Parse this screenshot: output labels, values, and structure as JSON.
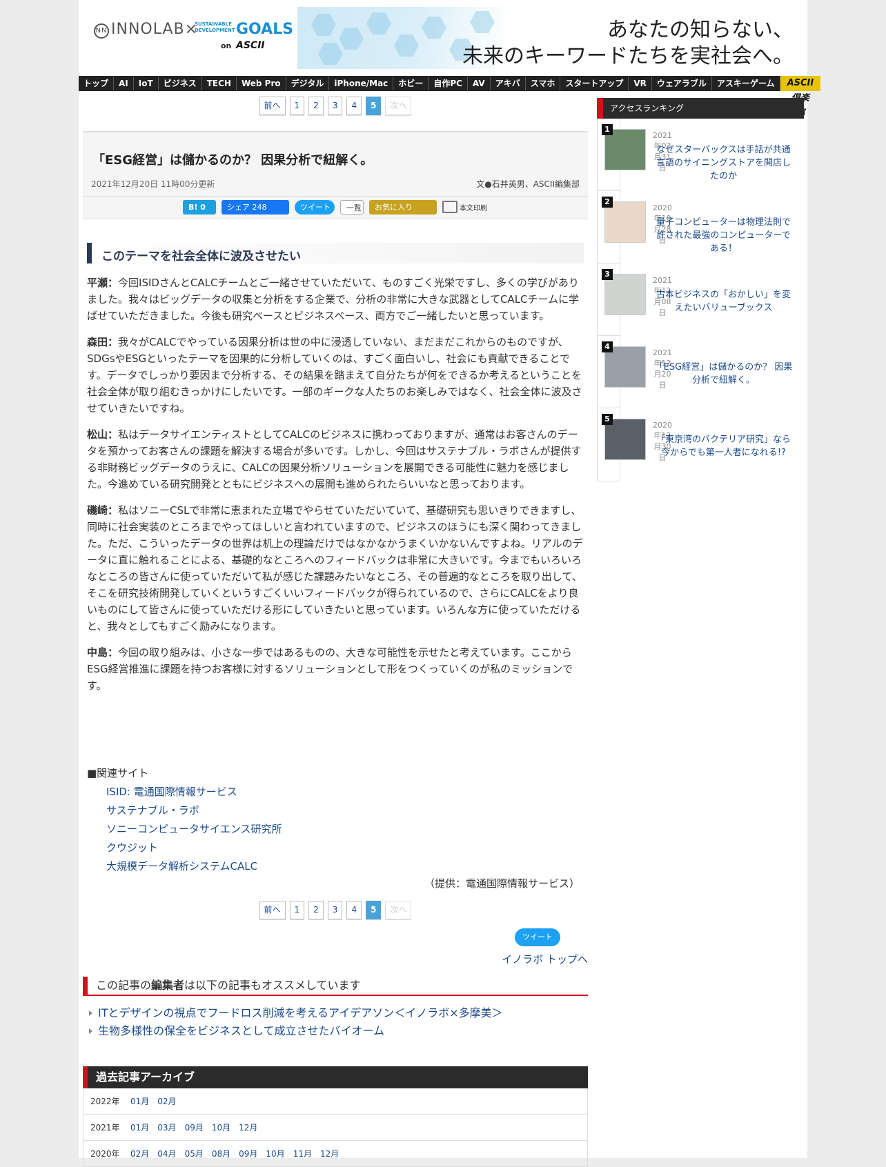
{
  "header": {
    "logo_innolab": "INNOLAB",
    "logo_x": "×",
    "logo_sdg_small_1": "SUSTAINABLE",
    "logo_sdg_small_2": "DEVELOPMENT",
    "logo_goals": "GOALS",
    "logo_on": "on",
    "logo_ascii": "ASCII",
    "banner_line1": "あなたの知らない、",
    "banner_line2": "未来のキーワードたちを実社会へ。"
  },
  "nav": {
    "items": [
      "トップ",
      "AI",
      "IoT",
      "ビジネス",
      "TECH",
      "Web Pro",
      "デジタル",
      "iPhone/Mac",
      "ホビー",
      "自作PC",
      "AV",
      "アキバ",
      "スマホ",
      "スタートアップ",
      "VR",
      "ウェアラブル",
      "アスキーゲーム"
    ],
    "club": "ASCII倶楽部"
  },
  "pager": {
    "prev": "前へ",
    "pages": [
      "1",
      "2",
      "3",
      "4",
      "5"
    ],
    "next": "次へ"
  },
  "article": {
    "title": "「ESG経営」は儲かるのか？ 因果分析で紐解く。",
    "date": "2021年12月20日 11時00分更新",
    "author": "文●石井英男、ASCII編集部",
    "share": {
      "hatena": "B! 0",
      "facebook": "シェア 248",
      "twitter": "ツイート",
      "list": "一覧",
      "fav": "お気に入り",
      "print": "本文印刷"
    },
    "section_heading": "このテーマを社会全体に波及させたい",
    "paragraphs": [
      {
        "speaker": "平瀬：",
        "text": "今回ISIDさんとCALCチームとご一緒させていただいて、ものすごく光栄ですし、多くの学びがありました。我々はビッグデータの収集と分析をする企業で、分析の非常に大きな武器としてCALCチームに学ばせていただきました。今後も研究ベースとビジネスベース、両方でご一緒したいと思っています。"
      },
      {
        "speaker": "森田：",
        "text": "我々がCALCでやっている因果分析は世の中に浸透していない、まだまだこれからのものですが、SDGsやESGといったテーマを因果的に分析していくのは、すごく面白いし、社会にも貢献できることです。データでしっかり要因まで分析する、その結果を踏まえて自分たちが何をできるか考えるということを社会全体が取り組むきっかけにしたいです。一部のギークな人たちのお楽しみではなく、社会全体に波及させていきたいですね。"
      },
      {
        "speaker": "松山：",
        "text": "私はデータサイエンティストとしてCALCのビジネスに携わっておりますが、通常はお客さんのデータを預かってお客さんの課題を解決する場合が多いです。しかし、今回はサステナブル・ラボさんが提供する非財務ビッグデータのうえに、CALCの因果分析ソリューションを展開できる可能性に魅力を感じました。今進めている研究開発とともにビジネスへの展開も進められたらいいなと思っております。"
      },
      {
        "speaker": "磯崎：",
        "text": "私はソニーCSLで非常に恵まれた立場でやらせていただいていて、基礎研究も思いきりできますし、同時に社会実装のところまでやってほしいと言われていますので、ビジネスのほうにも深く関わってきました。ただ、こういったデータの世界は机上の理論だけではなかなかうまくいかないんですよね。リアルのデータに直に触れることによる、基礎的なところへのフィードバックは非常に大きいです。今までもいろいろなところの皆さんに使っていただいて私が感じた課題みたいなところ、その普遍的なところを取り出して、そこを研究技術開発していくというすごくいいフィードバックが得られているので、さらにCALCをより良いものにして皆さんに使っていただける形にしていきたいと思っています。いろんな方に使っていただけると、我々としてもすごく励みになります。"
      },
      {
        "speaker": "中島：",
        "text": "今回の取り組みは、小さな一歩ではあるものの、大きな可能性を示せたと考えています。ここからESG経営推進に課題を持つお客様に対するソリューションとして形をつくっていくのが私のミッションです。"
      }
    ],
    "related_head": "■関連サイト",
    "related_links": [
      "ISID: 電通国際情報サービス",
      "サステナブル・ラボ",
      "ソニーコンピュータサイエンス研究所",
      "クウジット",
      "大規模データ解析システムCALC"
    ],
    "credit": "（提供：電通国際情報サービス）",
    "tweet2": "ツイート",
    "top_link": " イノラボ トップへ"
  },
  "recommend": {
    "heading_pre": "この記事の",
    "heading_em": "編集者",
    "heading_post": "は以下の記事もオススメしています ",
    "items": [
      "ITとデザインの視点でフードロス削減を考えるアイデアソン＜イノラボ×多摩美＞",
      "生物多様性の保全をビジネスとして成立させたバイオーム"
    ]
  },
  "archive": {
    "heading": "過去記事アーカイブ",
    "rows": [
      {
        "year": "2022年",
        "months": [
          "01月",
          "02月"
        ]
      },
      {
        "year": "2021年",
        "months": [
          "01月",
          "03月",
          "09月",
          "10月",
          "12月"
        ]
      },
      {
        "year": "2020年",
        "months": [
          "02月",
          "04月",
          "05月",
          "08月",
          "09月",
          "10月",
          "11月",
          "12月"
        ]
      }
    ]
  },
  "sidebar": {
    "heading": "アクセスランキング",
    "items": [
      {
        "rank": "1",
        "date": "2021年03月31日",
        "title": "なぜスターバックスは手話が共通言語のサイニングストアを開店したのか"
      },
      {
        "rank": "2",
        "date": "2020年10月28日",
        "title": "量子コンピューターは物理法則で許された最強のコンピューターである！"
      },
      {
        "rank": "3",
        "date": "2021年12月08日",
        "title": "古本ビジネスの「おかしい」を変えたいバリューブックス"
      },
      {
        "rank": "4",
        "date": "2021年12月20日",
        "title": "「ESG経営」は儲かるのか？ 因果分析で紐解く。"
      },
      {
        "rank": "5",
        "date": "2020年12月30日",
        "title": "「東京湾のバクテリア研究」なら今からでも第一人者になれる!?"
      }
    ]
  }
}
